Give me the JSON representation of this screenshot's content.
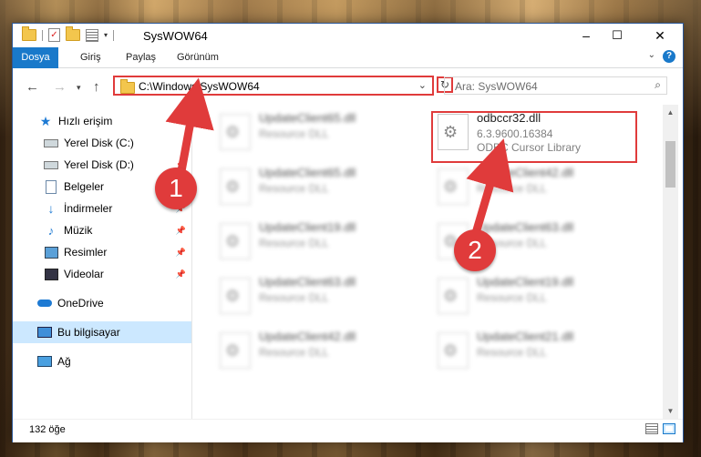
{
  "window": {
    "title": "SysWOW64",
    "controls": [
      "–",
      "☐",
      "✕"
    ]
  },
  "ribbon": {
    "tabs": [
      "Dosya",
      "Giriş",
      "Paylaş",
      "Görünüm"
    ]
  },
  "address": {
    "path": "C:\\Windows\\SysWOW64",
    "search_placeholder": "Ara: SysWOW64"
  },
  "sidebar": {
    "items": [
      {
        "label": "Hızlı erişim",
        "icon": "star-icon",
        "pinned": false
      },
      {
        "label": "Yerel Disk (C:)",
        "icon": "drive-icon",
        "pinned": false
      },
      {
        "label": "Yerel Disk (D:)",
        "icon": "drive-icon",
        "pinned": true
      },
      {
        "label": "Belgeler",
        "icon": "document-icon",
        "pinned": true
      },
      {
        "label": "İndirmeler",
        "icon": "download-icon",
        "pinned": true
      },
      {
        "label": "Müzik",
        "icon": "music-icon",
        "pinned": true
      },
      {
        "label": "Resimler",
        "icon": "picture-icon",
        "pinned": true
      },
      {
        "label": "Videolar",
        "icon": "video-icon",
        "pinned": true
      },
      {
        "label": "OneDrive",
        "icon": "onedrive-icon",
        "pinned": false
      },
      {
        "label": "Bu bilgisayar",
        "icon": "computer-icon",
        "pinned": false,
        "selected": true
      },
      {
        "label": "Ağ",
        "icon": "network-icon",
        "pinned": false
      }
    ]
  },
  "files": {
    "left": [
      {
        "name": "UpdateClient65.dll",
        "type": "Resource DLL"
      },
      {
        "name": "UpdateClient65.dll",
        "type": "Resource DLL"
      },
      {
        "name": "UpdateClient19.dll",
        "type": "Resource DLL"
      },
      {
        "name": "UpdateClient63.dll",
        "type": "Resource DLL"
      },
      {
        "name": "UpdateClient42.dll",
        "type": "Resource DLL"
      }
    ],
    "right_target": {
      "name": "odbccr32.dll",
      "version": "6.3.9600.16384",
      "description": "ODBC Cursor Library"
    },
    "right": [
      {
        "name": "UpdateClient42.dll",
        "type": "Resource DLL"
      },
      {
        "name": "UpdateClient63.dll",
        "type": "Resource DLL"
      },
      {
        "name": "UpdateClient19.dll",
        "type": "Resource DLL"
      },
      {
        "name": "UpdateClient21.dll",
        "type": "Resource DLL"
      }
    ]
  },
  "status": {
    "item_count": "132 öğe"
  },
  "annotations": {
    "step1": "1",
    "step2": "2",
    "accent_color": "#e03b3b"
  },
  "colors": {
    "ribbon_file_tab": "#1979ca",
    "selection": "#cce8ff"
  }
}
